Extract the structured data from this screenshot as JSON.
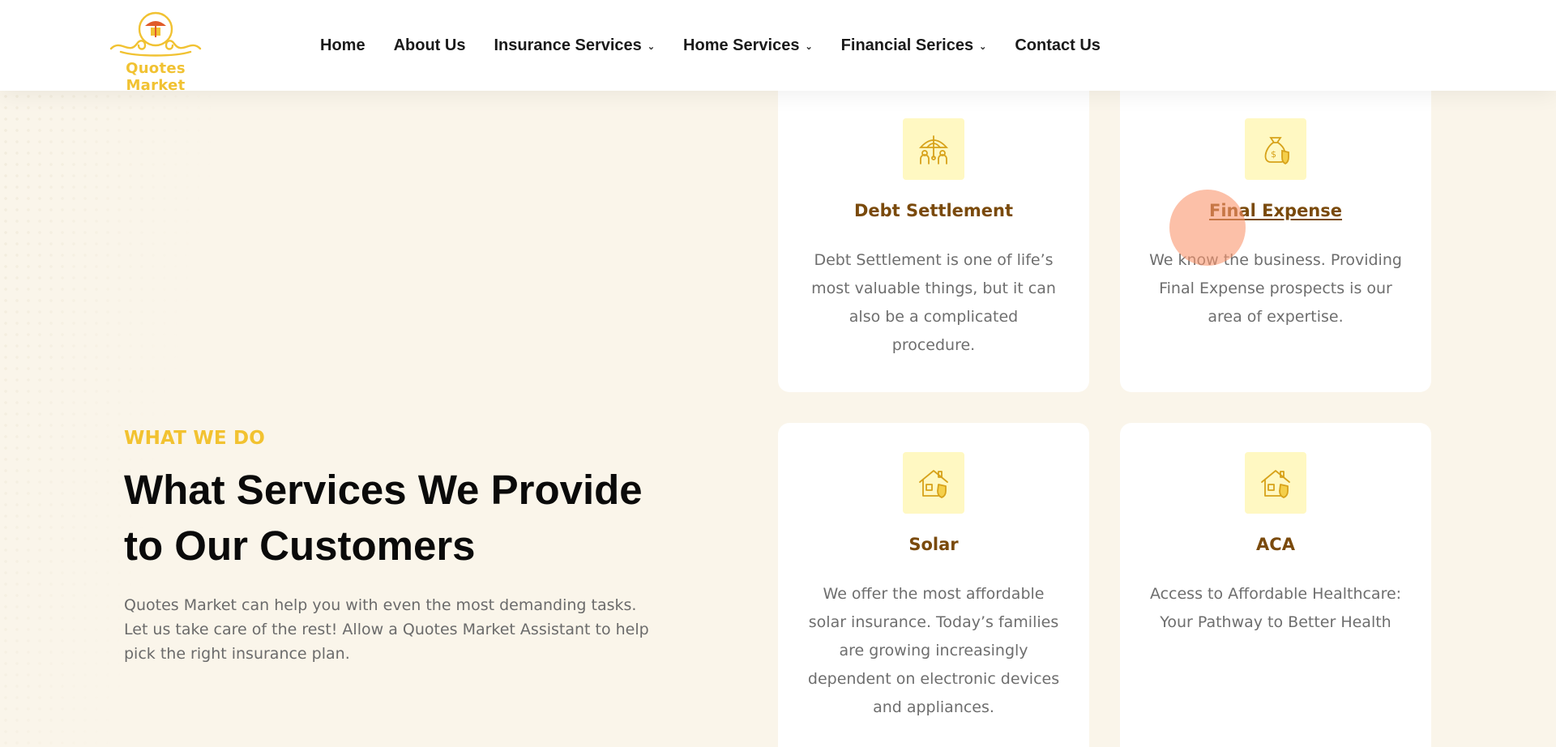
{
  "brand": {
    "name": "Quotes Market",
    "color": "#f1c232"
  },
  "nav": {
    "items": [
      {
        "label": "Home",
        "dropdown": false
      },
      {
        "label": "About Us",
        "dropdown": false
      },
      {
        "label": "Insurance Services",
        "dropdown": true
      },
      {
        "label": "Home Services",
        "dropdown": true
      },
      {
        "label": "Financial Serices",
        "dropdown": true
      },
      {
        "label": "Contact Us",
        "dropdown": false
      }
    ]
  },
  "section": {
    "eyebrow": "WHAT WE DO",
    "heading": "What Services We Provide to Our Customers",
    "intro": "Quotes Market can help you with even the most demanding tasks. Let us take care of the rest! Allow a Quotes Market Assistant to help pick the right insurance plan."
  },
  "cards": [
    {
      "title": "Debt Settlement",
      "icon": "umbrella-family-icon",
      "description": "Debt Settlement is one of life’s most valuable things, but it can also be a complicated procedure."
    },
    {
      "title": "Final Expense",
      "icon": "money-bag-shield-icon",
      "description": "We know the business. Providing Final Expense prospects is our area of expertise."
    },
    {
      "title": "Solar",
      "icon": "house-shield-icon",
      "description": "We offer the most affordable solar insurance. Today’s families are growing increasingly dependent on electronic devices and appliances."
    },
    {
      "title": "ACA",
      "icon": "house-shield-icon",
      "description": "Access to Affordable Healthcare: Your Pathway to Better Health"
    }
  ],
  "colors": {
    "accent": "#f2c230",
    "card_title": "#7a4a0c",
    "background": "#faf5ea",
    "icon_bg": "#fff8c2"
  }
}
